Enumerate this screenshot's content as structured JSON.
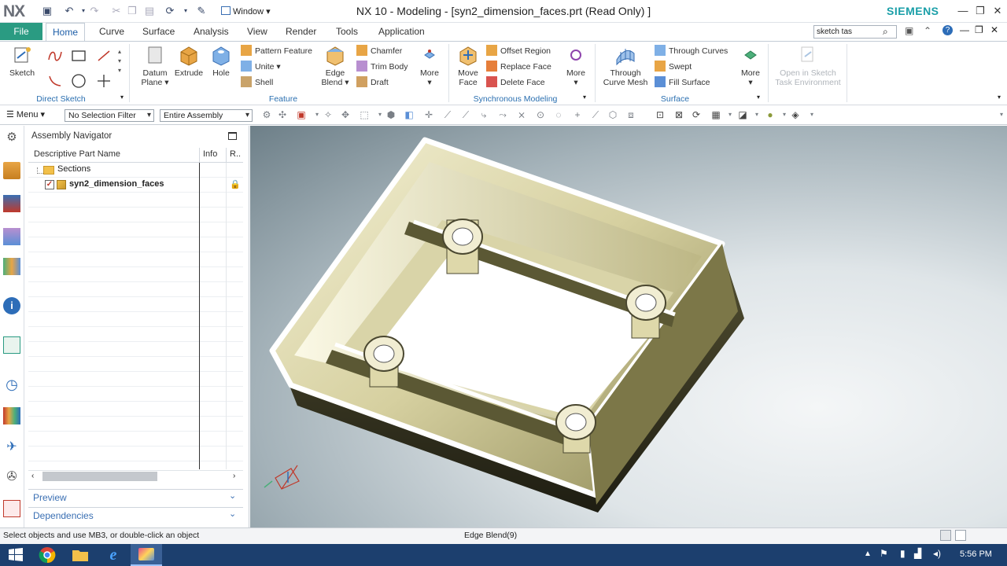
{
  "app": {
    "logo": "NX",
    "title": "NX 10 - Modeling - [syn2_dimension_faces.prt  (Read Only) ]",
    "brand": "SIEMENS",
    "window_menu": "Window",
    "brand_color": "#1a9fa8",
    "accent_color": "#2a9b82"
  },
  "tabs": {
    "file": "File",
    "items": [
      "Home",
      "Curve",
      "Surface",
      "Analysis",
      "View",
      "Render",
      "Tools",
      "Application"
    ],
    "active": "Home"
  },
  "search": {
    "value": "sketch tas"
  },
  "ribbon": {
    "sketch": "Sketch",
    "direct_sketch_label": "Direct Sketch",
    "datum_plane": [
      "Datum",
      "Plane"
    ],
    "extrude": "Extrude",
    "hole": "Hole",
    "pattern_feature": "Pattern Feature",
    "unite": "Unite",
    "shell": "Shell",
    "edge_blend": [
      "Edge",
      "Blend"
    ],
    "chamfer": "Chamfer",
    "trim_body": "Trim Body",
    "draft": "Draft",
    "more": "More",
    "feature_label": "Feature",
    "move_face": [
      "Move",
      "Face"
    ],
    "offset_region": "Offset Region",
    "replace_face": "Replace Face",
    "delete_face": "Delete Face",
    "sync_label": "Synchronous Modeling",
    "through_curve_mesh": [
      "Through",
      "Curve Mesh"
    ],
    "through_curves": "Through Curves",
    "swept": "Swept",
    "fill_surface": "Fill Surface",
    "surface_label": "Surface",
    "open_sketch": [
      "Open in Sketch",
      "Task Environment"
    ]
  },
  "toolbar": {
    "menu": "Menu",
    "selection_filter": "No Selection Filter",
    "scope": "Entire Assembly"
  },
  "navigator": {
    "title": "Assembly Navigator",
    "columns": [
      "Descriptive Part Name",
      "Info",
      "R.."
    ],
    "rows": [
      {
        "name": "Sections",
        "icon": "folder-icon"
      },
      {
        "name": "syn2_dimension_faces",
        "icon": "part-icon",
        "checked": true,
        "locked": true
      }
    ],
    "preview": "Preview",
    "dependencies": "Dependencies"
  },
  "status": {
    "message": "Select objects and use MB3, or double-click an object",
    "center": "Edge Blend(9)"
  },
  "taskbar": {
    "time": "5:56 PM"
  }
}
